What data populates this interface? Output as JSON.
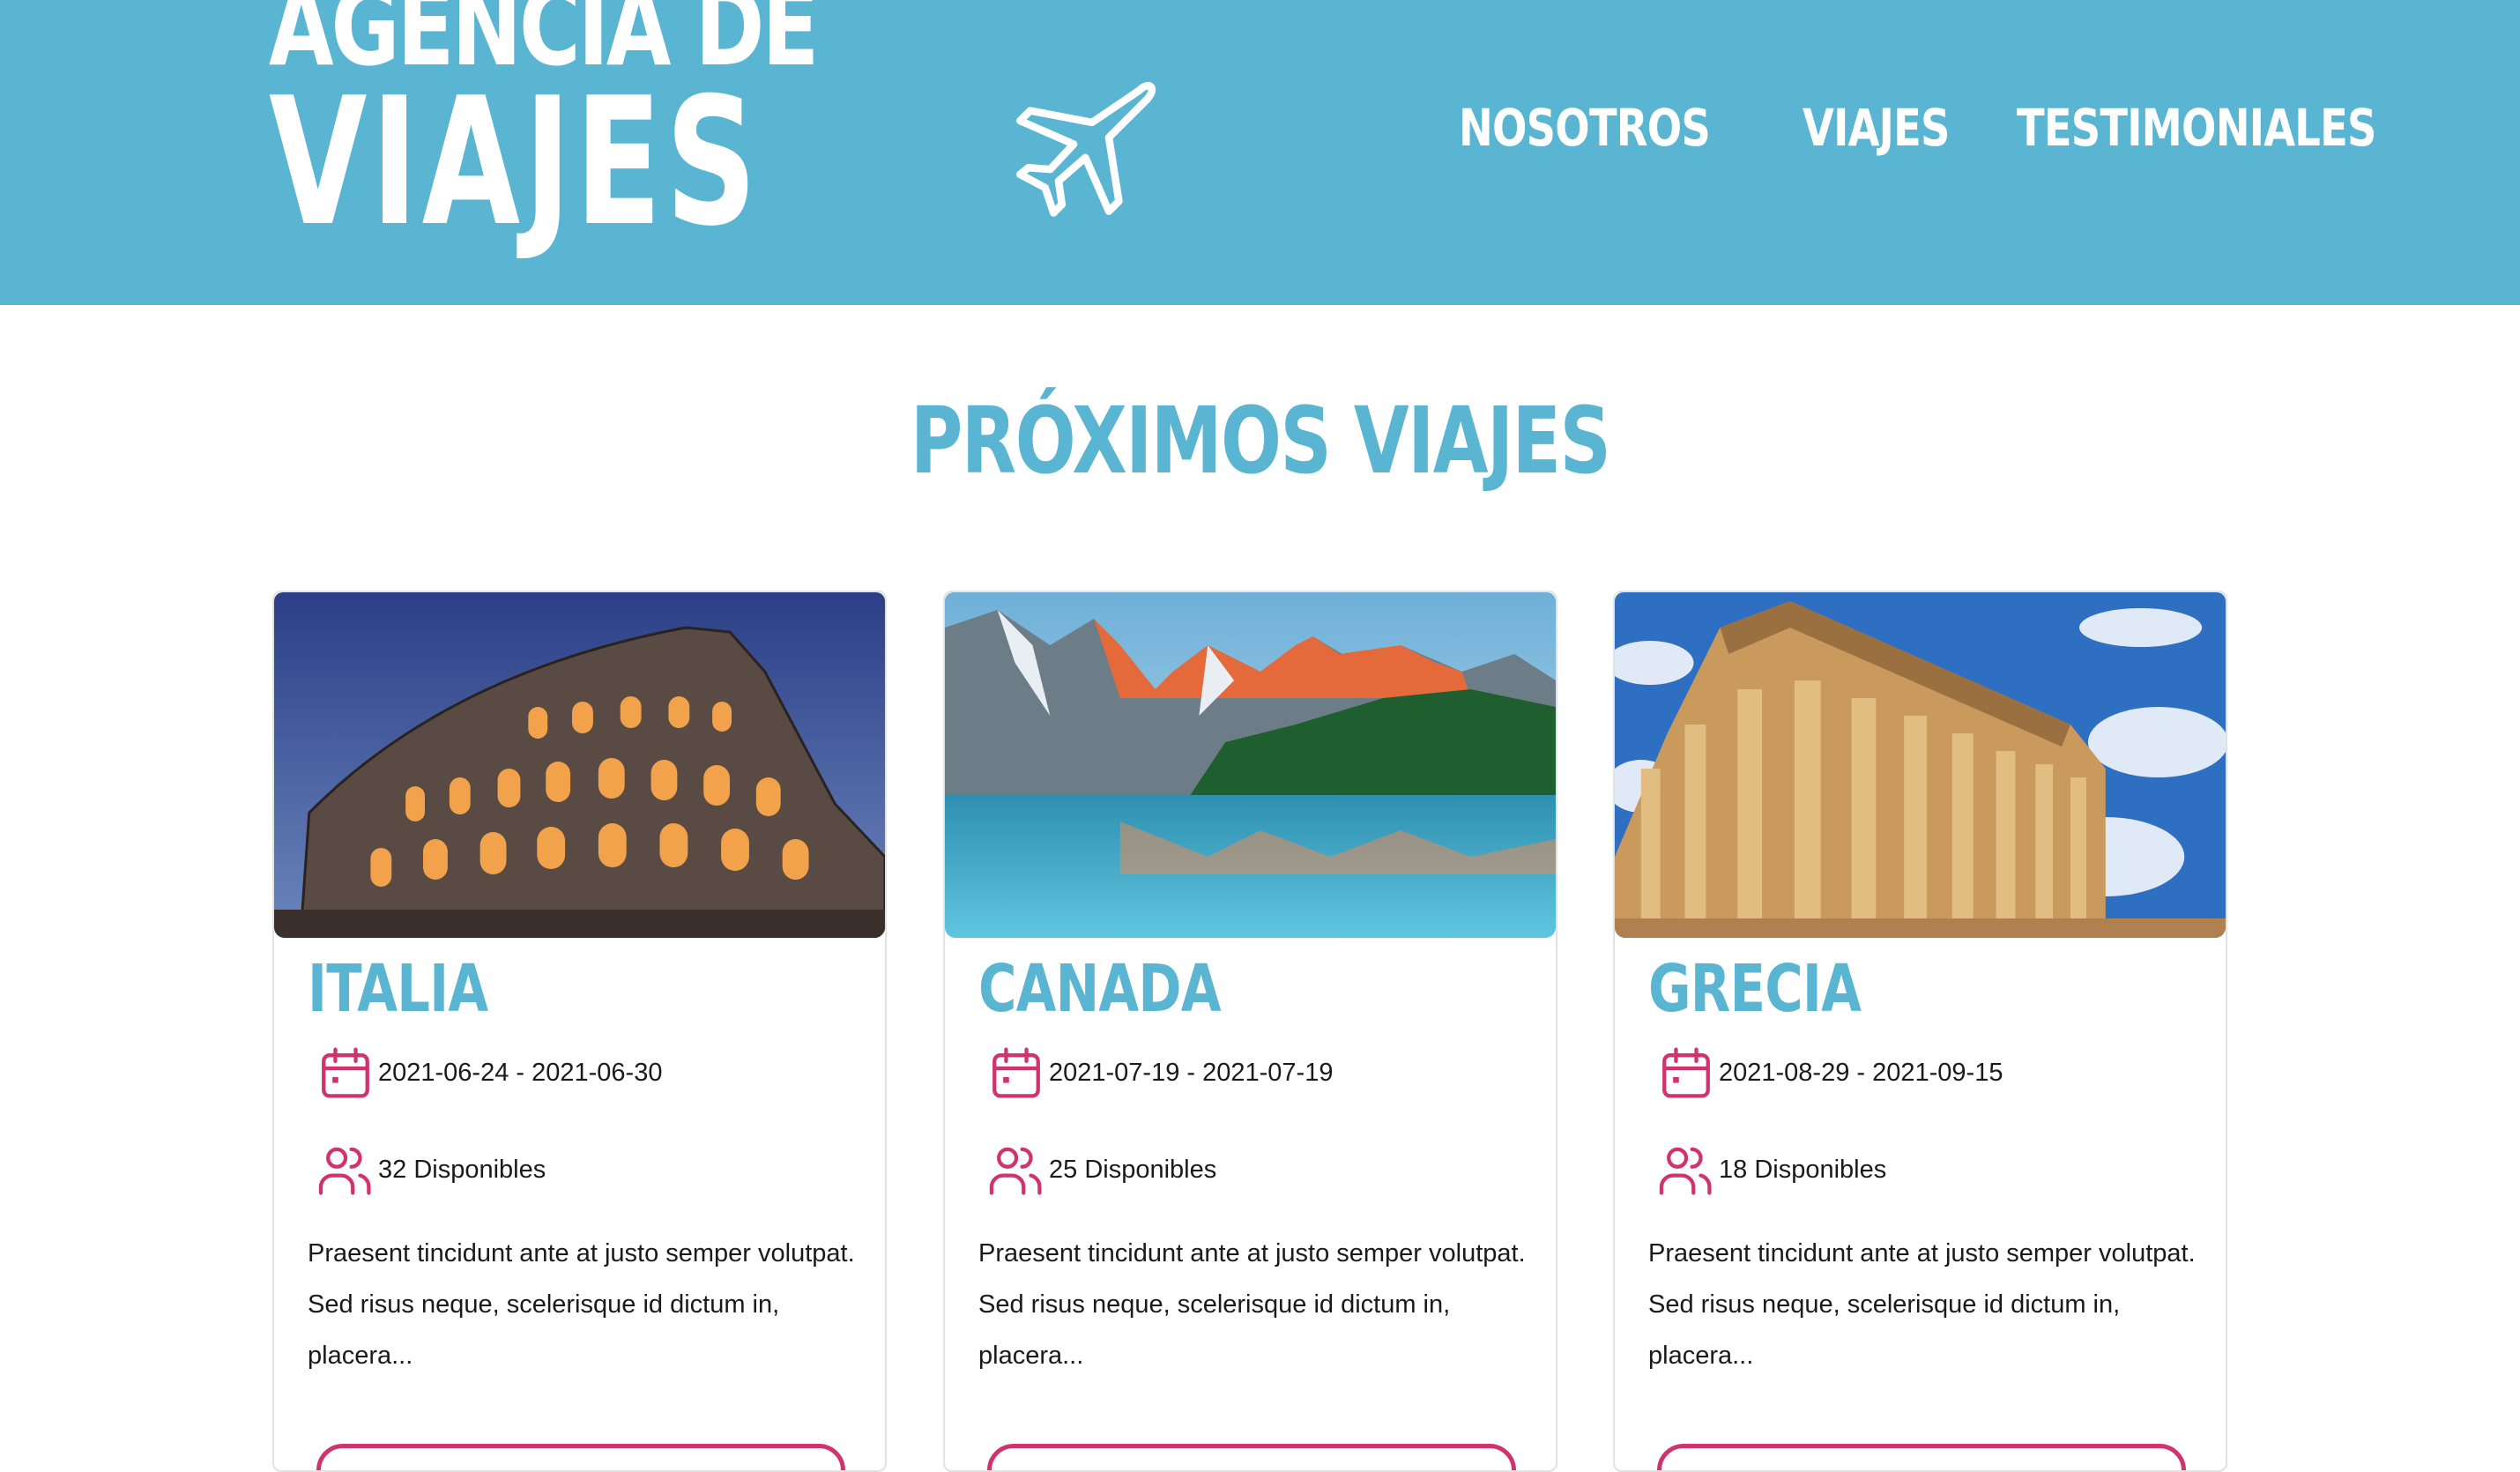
{
  "header": {
    "logo_line1": "AGENCIA DE",
    "logo_line2": "VIAJES",
    "logo_icon": "airplane-icon",
    "nav": [
      "NOSOTROS",
      "VIAJES",
      "TESTIMONIALES"
    ]
  },
  "section_title": "PRÓXIMOS VIAJES",
  "colors": {
    "header_bg": "#5ab5d3",
    "accent": "#d0336e",
    "title": "#5ab5d3"
  },
  "trips": [
    {
      "title": "ITALIA",
      "dates": "2021-06-24 - 2021-06-30",
      "available": "32 Disponibles",
      "description": "Praesent tincidunt ante at justo semper volutpat. Sed risus neque, scelerisque id dictum in, placera...",
      "image": "colosseum-photo"
    },
    {
      "title": "CANADA",
      "dates": "2021-07-19 - 2021-07-19",
      "available": "25 Disponibles",
      "description": "Praesent tincidunt ante at justo semper volutpat. Sed risus neque, scelerisque id dictum in, placera...",
      "image": "mountain-lake-photo"
    },
    {
      "title": "GRECIA",
      "dates": "2021-08-29 - 2021-09-15",
      "available": "18 Disponibles",
      "description": "Praesent tincidunt ante at justo semper volutpat. Sed risus neque, scelerisque id dictum in, placera...",
      "image": "parthenon-photo"
    }
  ]
}
